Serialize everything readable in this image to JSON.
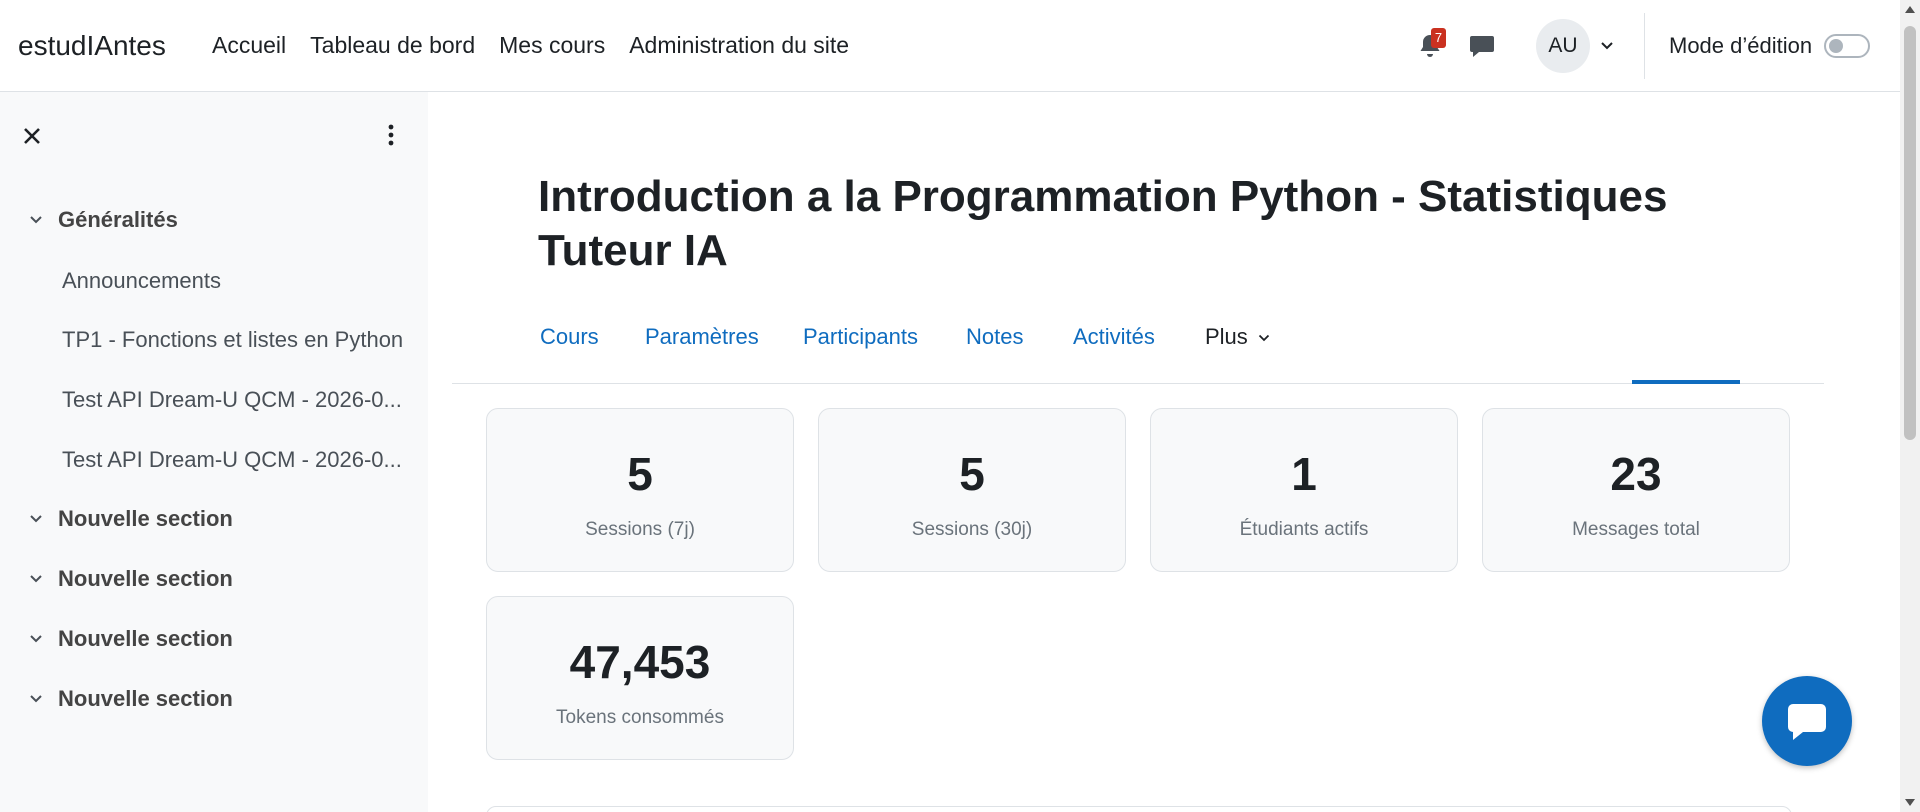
{
  "header": {
    "brand": "estudIAntes",
    "nav": [
      "Accueil",
      "Tableau de bord",
      "Mes cours",
      "Administration du site"
    ],
    "notifications_count": "7",
    "avatar_initials": "AU",
    "edit_mode_label": "Mode d’édition",
    "edit_mode_on": false
  },
  "course_index": {
    "sections": [
      {
        "label": "Généralités",
        "expanded": true
      },
      {
        "label": "Nouvelle section",
        "expanded": true
      },
      {
        "label": "Nouvelle section",
        "expanded": true
      },
      {
        "label": "Nouvelle section",
        "expanded": true
      },
      {
        "label": "Nouvelle section",
        "expanded": true
      }
    ],
    "activities": [
      "Announcements",
      "TP1 - Fonctions et listes en Python",
      "Test API Dream-U QCM - 2026-0...",
      "Test API Dream-U QCM - 2026-0..."
    ]
  },
  "page": {
    "title_line1": "Introduction a la Programmation Python - Statistiques",
    "title_line2": "Tuteur IA"
  },
  "tabs": [
    {
      "label": "Cours",
      "active": false
    },
    {
      "label": "Paramètres",
      "active": false
    },
    {
      "label": "Participants",
      "active": false
    },
    {
      "label": "Notes",
      "active": false
    },
    {
      "label": "Activités",
      "active": false
    },
    {
      "label": "Plus",
      "active": true
    }
  ],
  "stats": [
    {
      "value": "5",
      "label": "Sessions (7j)"
    },
    {
      "value": "5",
      "label": "Sessions (30j)"
    },
    {
      "value": "1",
      "label": "Étudiants actifs"
    },
    {
      "value": "23",
      "label": "Messages total"
    },
    {
      "value": "47,453",
      "label": "Tokens consommés"
    }
  ],
  "colors": {
    "link": "#0f6cbf",
    "badge": "#ca3120",
    "drawer_bg": "#f8f9fa"
  }
}
